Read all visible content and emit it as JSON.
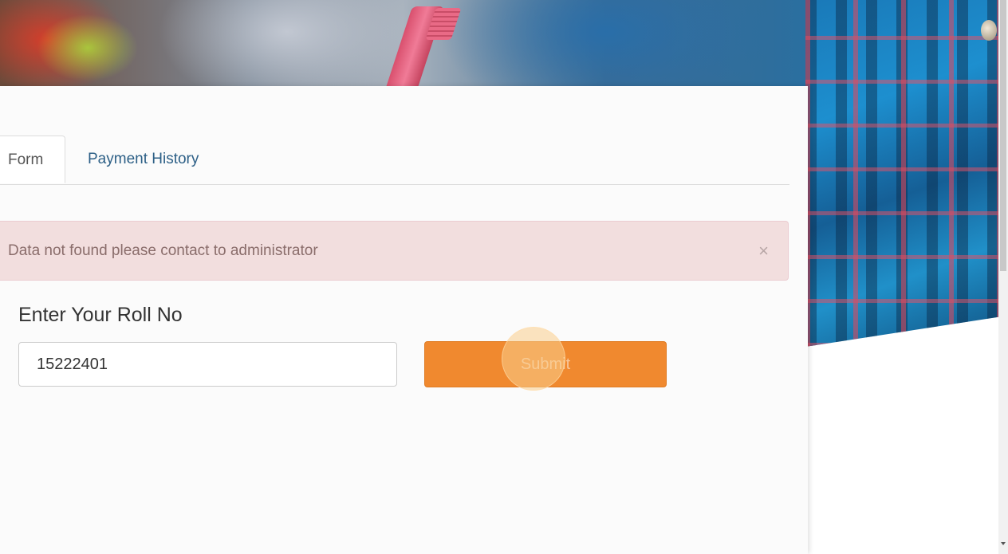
{
  "tabs": [
    {
      "label": "Form",
      "active": true
    },
    {
      "label": "Payment History",
      "active": false
    }
  ],
  "alert": {
    "message": "Data not found please contact to administrator",
    "close_glyph": "×"
  },
  "form": {
    "roll_label": "Enter Your Roll No",
    "roll_value": "15222401",
    "submit_label": "Submit"
  },
  "colors": {
    "accent": "#f0892f",
    "alert_bg": "#f2dede",
    "alert_text": "#8a6d6b",
    "tab_link": "#2c5f86"
  }
}
